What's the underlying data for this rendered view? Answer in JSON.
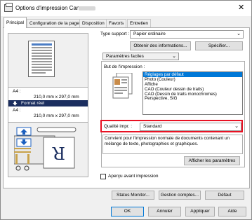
{
  "window": {
    "title": "Options d'impression Canon",
    "close": "✕"
  },
  "tabs": [
    "Principal",
    "Configuration de la page",
    "Disposition",
    "Favoris",
    "Entretien"
  ],
  "preview": {
    "size1_label": "A4 :",
    "size1_value": "210,0 mm x 297,0 mm",
    "format_label": "Format réel",
    "size2_label": "A4 :",
    "size2_value": "210,0 mm x 297,0 mm"
  },
  "media": {
    "label": "Type support :",
    "value": "Papier ordinaire",
    "info_button": "Obtenir des informations...",
    "spec_button": "Spécifier..."
  },
  "settings_dropdown": "Paramètres faciles",
  "purpose": {
    "label": "But de l'impression :",
    "items": [
      "Réglages par défaut",
      "Photo (Couleur)",
      "Affiche",
      "CAO (Couleur dessin de traits)",
      "CAO (Dessin de traits monochromes)",
      "Perspective, SIG"
    ],
    "selected_index": 0
  },
  "quality": {
    "label": "Qualité impr. :",
    "value": "Standard"
  },
  "description": "Convient pour l'impression normale de documents contenant un mélange de texte, photographies et graphiques.",
  "show_settings_button": "Afficher les paramètres",
  "preview_checkbox": {
    "label": "Aperçu avant impression",
    "checked": false
  },
  "bottom_buttons": {
    "status": "Status Monitor...",
    "accounting": "Gestion comptes...",
    "defaults": "Défaut"
  },
  "dialog_buttons": {
    "ok": "OK",
    "cancel": "Annuler",
    "apply": "Appliquer",
    "help": "Aide"
  },
  "colors": {
    "highlight": "#e81123",
    "selection": "#0078d7",
    "arrow_blue": "#1b5fbf"
  }
}
